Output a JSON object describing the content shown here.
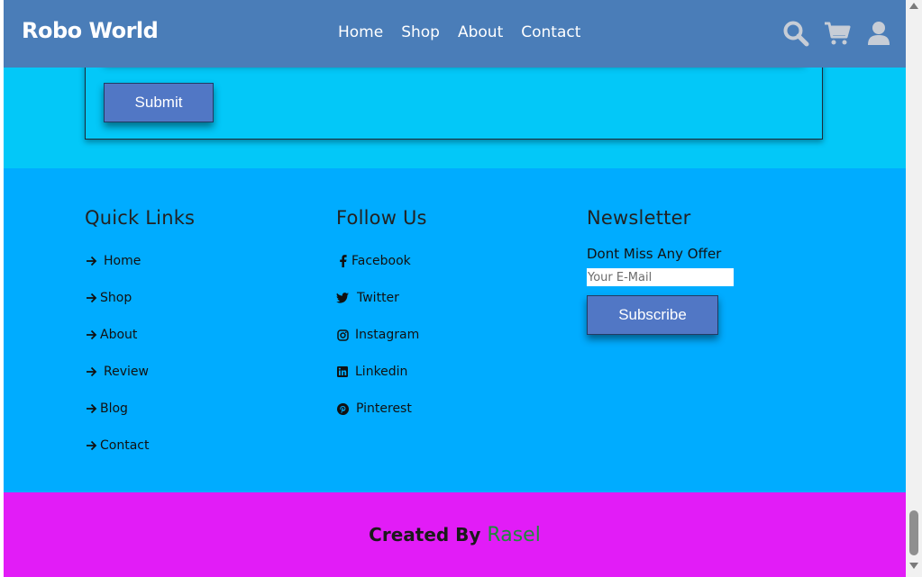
{
  "header": {
    "logo": "Robo World",
    "nav": [
      "Home",
      "Shop",
      "About",
      "Contact"
    ],
    "icons": [
      "search-icon",
      "cart-icon",
      "user-icon"
    ]
  },
  "contact_form": {
    "submit_label": "Submit"
  },
  "footer": {
    "quick_links": {
      "title": "Quick Links",
      "items": [
        "Home",
        "Shop",
        "About",
        "Review",
        "Blog",
        "Contact"
      ]
    },
    "follow_us": {
      "title": "Follow Us",
      "items": [
        {
          "label": "Facebook",
          "icon": "facebook-icon"
        },
        {
          "label": "Twitter",
          "icon": "twitter-icon"
        },
        {
          "label": "Instagram",
          "icon": "instagram-icon"
        },
        {
          "label": "Linkedin",
          "icon": "linkedin-icon"
        },
        {
          "label": "Pinterest",
          "icon": "pinterest-icon"
        }
      ]
    },
    "newsletter": {
      "title": "Newsletter",
      "text": "Dont Miss Any Offer",
      "placeholder": "Your E-Mail",
      "button": "Subscribe"
    }
  },
  "credit": {
    "prefix": "Created By",
    "name": "Rasel"
  },
  "colors": {
    "header": "#4a7db8",
    "contact_bg": "#03c8f8",
    "footer_bg": "#00acff",
    "credit_bg": "#e21cf7",
    "button": "#5177c5",
    "credit_name": "#1f8a3a"
  }
}
